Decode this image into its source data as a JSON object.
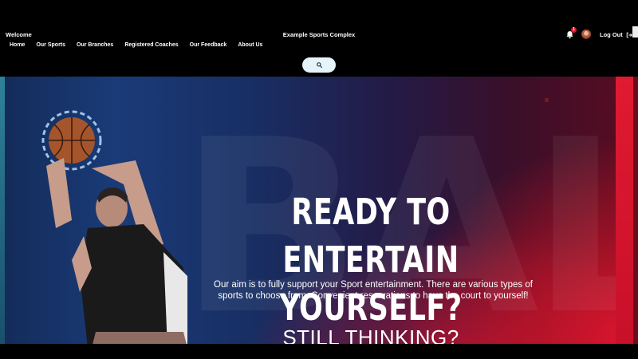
{
  "header": {
    "welcome": "Welcome",
    "site_title": "Example Sports Complex",
    "nav": [
      "Home",
      "Our Sports",
      "Our Branches",
      "Registered Coaches",
      "Our Feedback",
      "About Us"
    ],
    "notification_count": "1",
    "logout_label": "Log Out"
  },
  "hero": {
    "title_line1": "READY TO ENTERTAIN",
    "title_line2": "YOURSELF?",
    "description": "Our aim is to fully support your Sport entertainment. There are various types of sports to choose from.  Convenient reservations to have the court to yourself!",
    "subheading": "STILL THINKING?",
    "watermark": "BALL"
  },
  "icons": {
    "search": "search-icon",
    "bell": "bell-icon",
    "logout": "logout-icon"
  },
  "colors": {
    "accent_red": "#e0162f",
    "deep_blue": "#1a3b78",
    "search_bg": "#e6f4fa"
  }
}
